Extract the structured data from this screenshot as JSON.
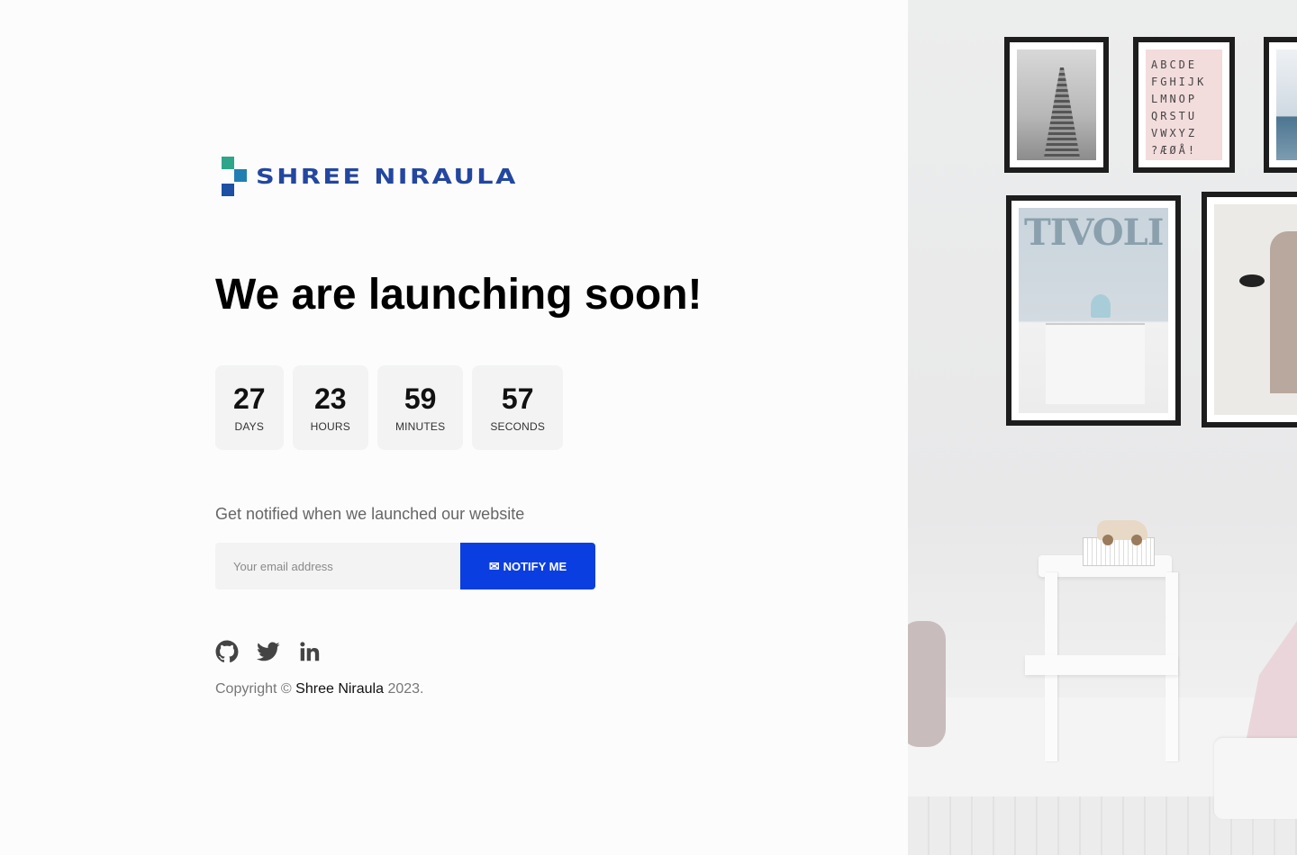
{
  "brand": {
    "name": "SHREE NIRAULA"
  },
  "headline": "We are launching soon!",
  "countdown": [
    {
      "value": "27",
      "label": "DAYS"
    },
    {
      "value": "23",
      "label": "HOURS"
    },
    {
      "value": "59",
      "label": "MINUTES"
    },
    {
      "value": "57",
      "label": "SECONDS"
    }
  ],
  "notify": {
    "text": "Get notified when we launched our website",
    "email_placeholder": "Your email address",
    "button_icon": "✉",
    "button_label": "NOTIFY ME"
  },
  "socials": [
    {
      "icon": "github-icon"
    },
    {
      "icon": "twitter-icon"
    },
    {
      "icon": "linkedin-icon"
    }
  ],
  "footer": {
    "prefix": "Copyright ©",
    "name": "Shree Niraula",
    "suffix": "2023."
  },
  "illustration": {
    "alphabet_poster": "ABCDE\nFGHIJK\nLMNOP\nQRSTU\nVWXYZ\n?ÆØÅ!",
    "tivoli_poster": "TIVOLI"
  },
  "colors": {
    "primary_button": "#0b3ee0",
    "logo_text": "#2346a0",
    "countdown_bg": "#f3f3f3"
  }
}
